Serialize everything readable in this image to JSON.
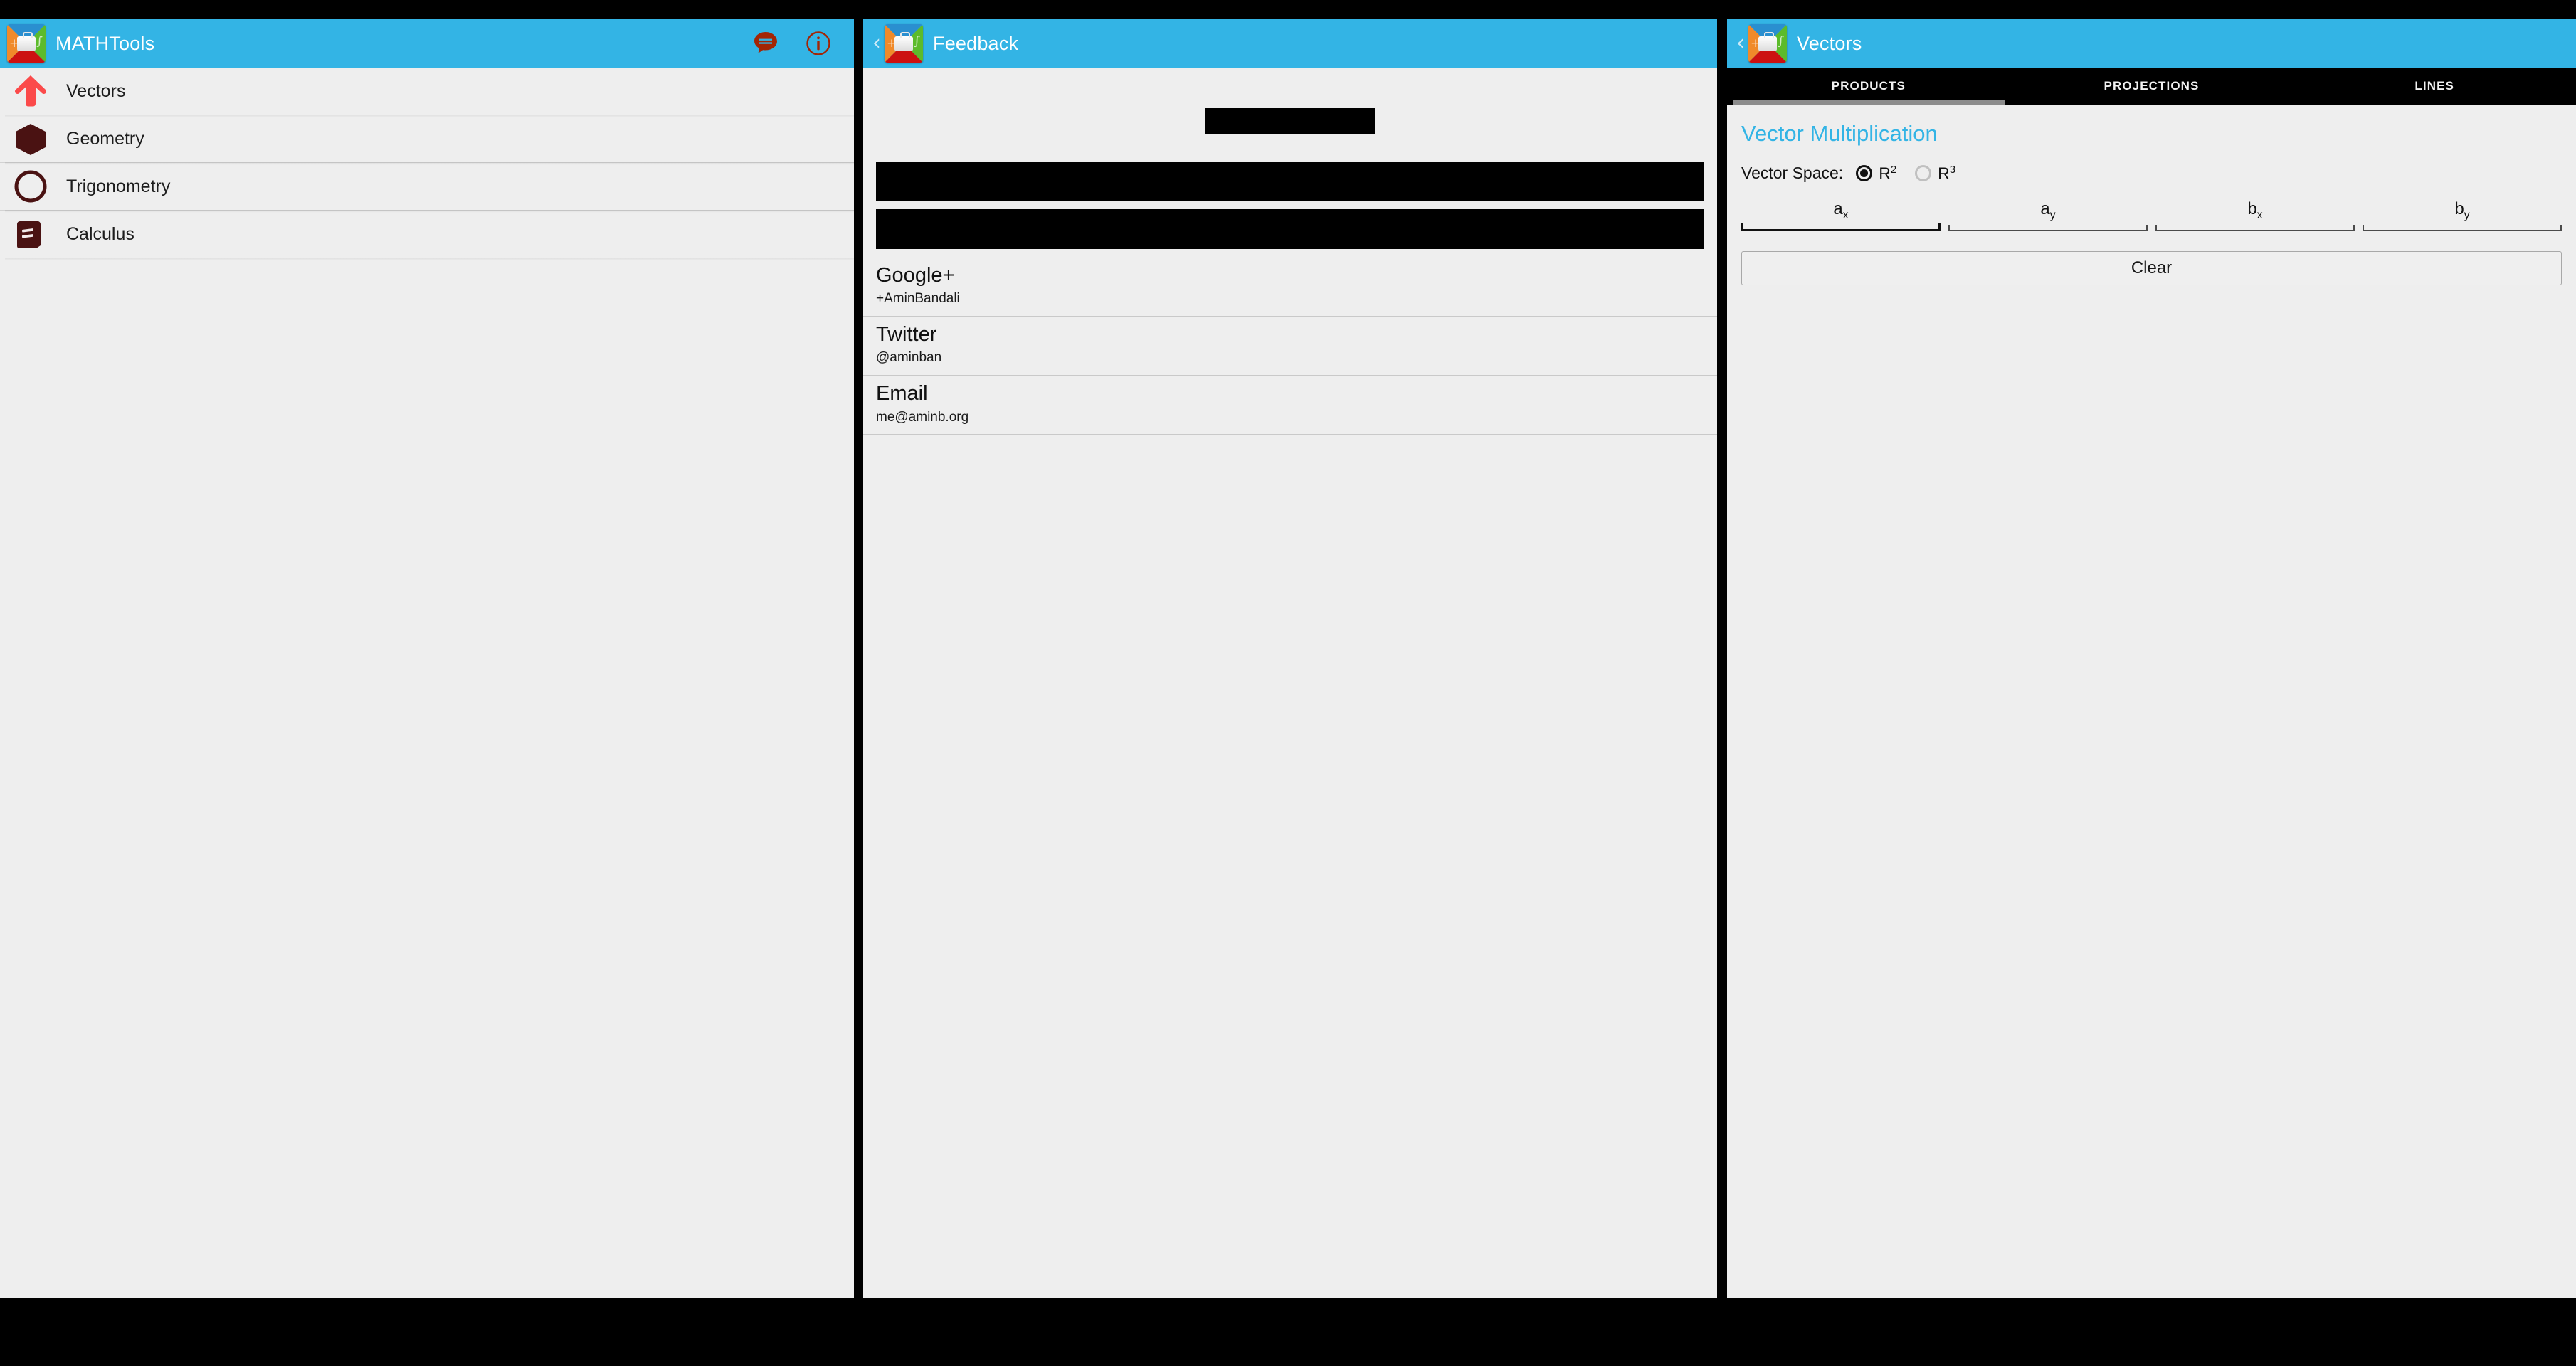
{
  "theme": {
    "accent_blue": "#33b4e5",
    "panel_bg": "#eeeeee",
    "tabbar_bg": "#000000",
    "tab_indicator": "#8c8c8c",
    "vectors_icon_color": "#fb4a4a",
    "nav_icon_color": "#4a1212",
    "actionbar_icon_color": "#a32505",
    "redaction_color": "#000000"
  },
  "left_panel": {
    "actionbar": {
      "title": "MATHTools",
      "app_icon": "mathtools-app-icon",
      "actions": [
        {
          "name": "feedback-icon",
          "icon": "speech-bubble-icon"
        },
        {
          "name": "about-icon",
          "icon": "info-circle-icon"
        }
      ]
    },
    "nav_items": [
      {
        "label": "Vectors",
        "icon": "up-arrow-icon"
      },
      {
        "label": "Geometry",
        "icon": "cube-icon"
      },
      {
        "label": "Trigonometry",
        "icon": "circle-icon"
      },
      {
        "label": "Calculus",
        "icon": "book-icon"
      }
    ]
  },
  "middle_panel": {
    "actionbar": {
      "title": "Feedback",
      "back": "‹",
      "app_icon": "mathtools-app-icon"
    },
    "redactions": [
      {
        "name": "redacted-logo-block"
      },
      {
        "name": "redacted-text-block-1"
      },
      {
        "name": "redacted-text-block-2"
      }
    ],
    "contacts": [
      {
        "title": "Google+",
        "subtitle": "+AminBandali"
      },
      {
        "title": "Twitter",
        "subtitle": "@aminban"
      },
      {
        "title": "Email",
        "subtitle": "me@aminb.org"
      }
    ]
  },
  "right_panel": {
    "actionbar": {
      "title": "Vectors",
      "back": "‹",
      "app_icon": "mathtools-app-icon"
    },
    "tabs": [
      {
        "label": "PRODUCTS",
        "active": true
      },
      {
        "label": "PROJECTIONS",
        "active": false
      },
      {
        "label": "LINES",
        "active": false
      }
    ],
    "section_title": "Vector Multiplication",
    "vector_space": {
      "label": "Vector Space:",
      "options": [
        {
          "base": "R",
          "exp": "2",
          "selected": true
        },
        {
          "base": "R",
          "exp": "3",
          "selected": false
        }
      ]
    },
    "fields": [
      {
        "hint_base": "a",
        "hint_sub": "x",
        "value": "",
        "focused": true
      },
      {
        "hint_base": "a",
        "hint_sub": "y",
        "value": "",
        "focused": false
      },
      {
        "hint_base": "b",
        "hint_sub": "x",
        "value": "",
        "focused": false
      },
      {
        "hint_base": "b",
        "hint_sub": "y",
        "value": "",
        "focused": false
      }
    ],
    "clear_label": "Clear"
  }
}
